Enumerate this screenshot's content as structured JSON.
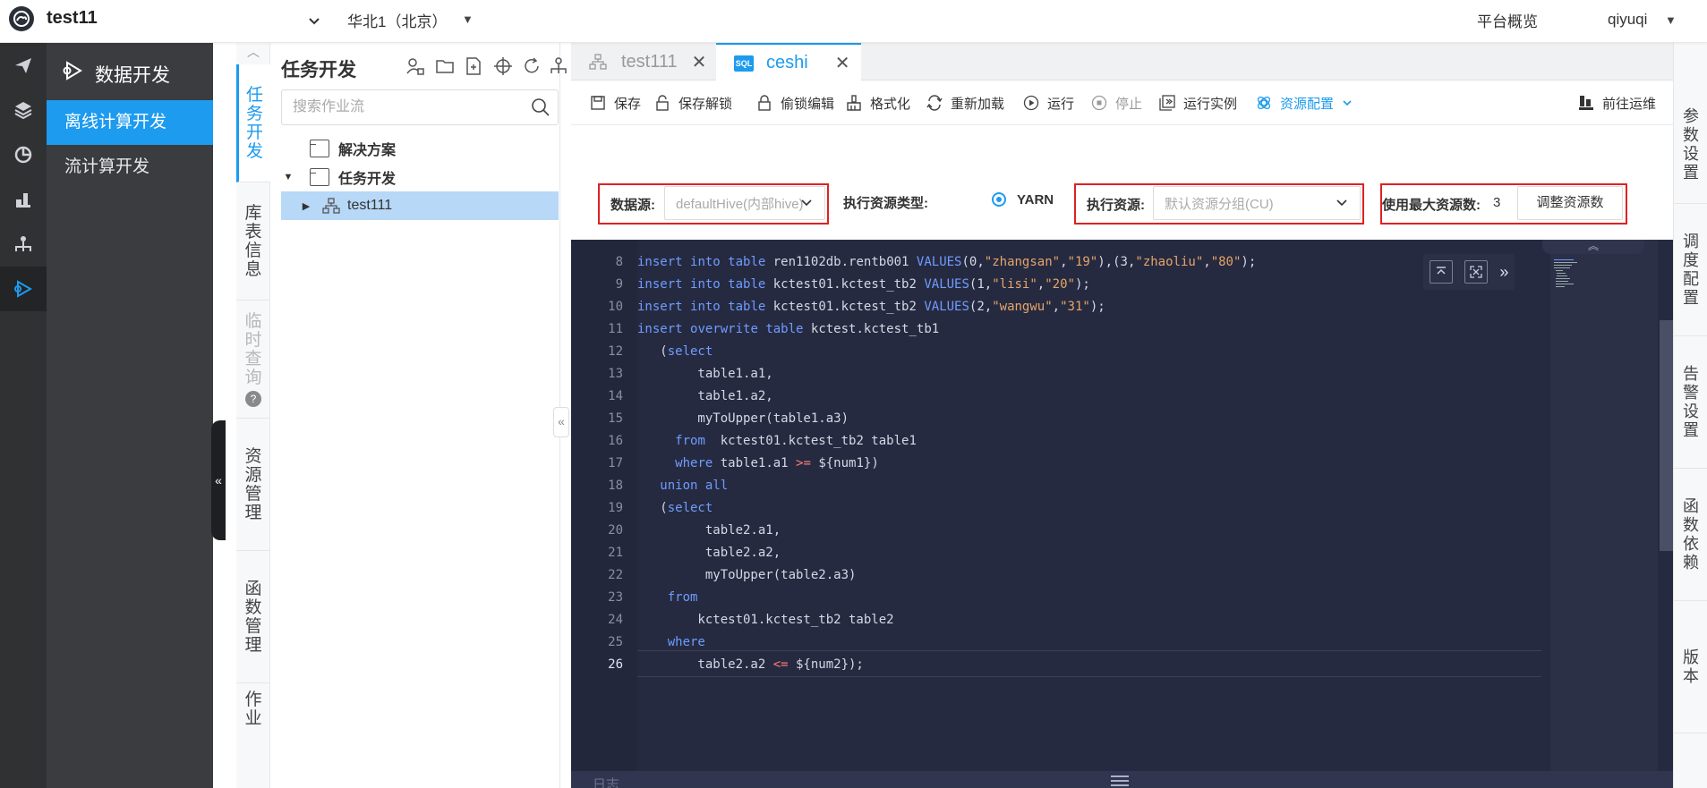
{
  "topbar": {
    "app_title": "test11",
    "region": "华北1（北京）",
    "platform_link": "平台概览",
    "user": "qiyuqi"
  },
  "rail": {
    "icons": [
      "send-icon",
      "layers-icon",
      "pie-chart-icon",
      "dashboard-icon",
      "org-chart-icon",
      "data-dev-icon"
    ]
  },
  "sidemenu": {
    "title": "数据开发",
    "items": [
      {
        "label": "离线计算开发"
      },
      {
        "label": "流计算开发"
      }
    ]
  },
  "vtabs": [
    {
      "label": "任务开发"
    },
    {
      "label": "库表信息"
    },
    {
      "label": "临时查询"
    },
    {
      "label": "资源管理"
    },
    {
      "label": "函数管理"
    },
    {
      "label": "作业"
    }
  ],
  "tree": {
    "title": "任务开发",
    "search_placeholder": "搜索作业流",
    "nodes": [
      {
        "label": "解决方案"
      },
      {
        "label": "任务开发"
      },
      {
        "label": "test111"
      }
    ]
  },
  "tabs": [
    {
      "label": "test111"
    },
    {
      "label": "ceshi",
      "badge": "SQL"
    }
  ],
  "toolbar": {
    "save": "保存",
    "save_unlock": "保存解锁",
    "steal_edit": "偷锁编辑",
    "format": "格式化",
    "reload": "重新加载",
    "run": "运行",
    "stop": "停止",
    "run_instance": "运行实例",
    "resource_config": "资源配置",
    "goto_ops": "前往运维"
  },
  "config": {
    "datasource_label": "数据源:",
    "datasource_value": "defaultHive(内部hive)",
    "exec_type_label": "执行资源类型:",
    "exec_type_value": "YARN",
    "exec_resource_label": "执行资源:",
    "exec_resource_value": "默认资源分组(CU)",
    "max_resource_label": "使用最大资源数:",
    "max_resource_value": "3",
    "adjust_button": "调整资源数"
  },
  "editor": {
    "current_line": "26",
    "lines": [
      {
        "n": "8"
      },
      {
        "n": "9"
      },
      {
        "n": "10"
      },
      {
        "n": "11"
      },
      {
        "n": "12"
      },
      {
        "n": "13"
      },
      {
        "n": "14"
      },
      {
        "n": "15"
      },
      {
        "n": "16"
      },
      {
        "n": "17"
      },
      {
        "n": "18"
      },
      {
        "n": "19"
      },
      {
        "n": "20"
      },
      {
        "n": "21"
      },
      {
        "n": "22"
      },
      {
        "n": "23"
      },
      {
        "n": "24"
      },
      {
        "n": "25"
      },
      {
        "n": "26"
      }
    ],
    "log_label": "日志"
  },
  "right_panel": [
    {
      "label": "参数设置"
    },
    {
      "label": "调度配置"
    },
    {
      "label": "告警设置"
    },
    {
      "label": "函数依赖"
    },
    {
      "label": "版本"
    }
  ],
  "colors": {
    "accent": "#1d9bef",
    "sidebar": "#3a3c3f",
    "editor_bg": "#262a40",
    "highlight_box": "#e02020"
  }
}
